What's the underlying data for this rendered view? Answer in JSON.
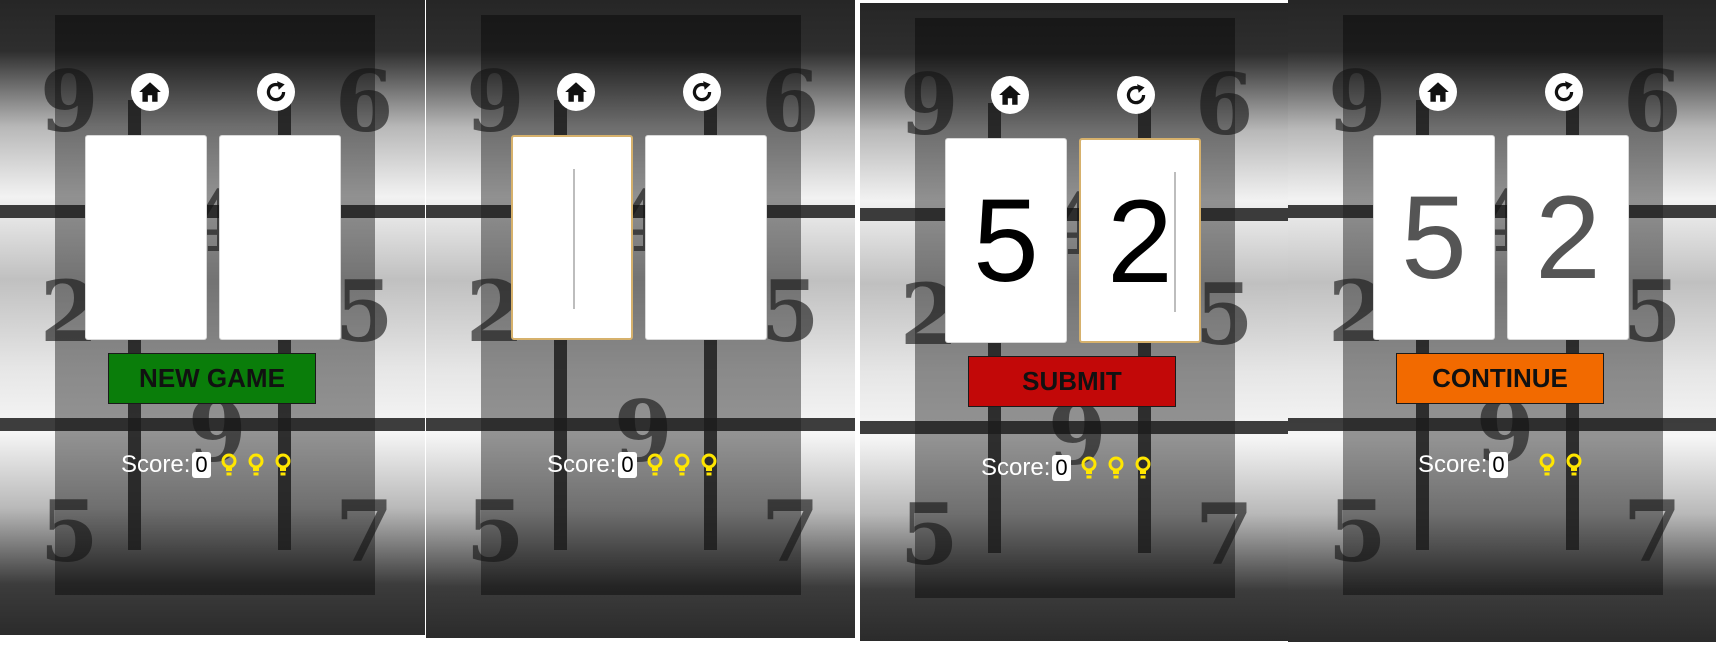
{
  "panels": [
    {
      "state": "new-game",
      "home_icon": "home-icon",
      "restart_icon": "restart-icon",
      "cards": [
        {
          "value": "",
          "focused": false
        },
        {
          "value": "",
          "focused": false
        }
      ],
      "action_label": "NEW GAME",
      "action_color": "#0a7d0a",
      "score_label": "Score:",
      "score_value": "0",
      "hints": 3
    },
    {
      "state": "input-focused",
      "home_icon": "home-icon",
      "restart_icon": "restart-icon",
      "cards": [
        {
          "value": "",
          "focused": true
        },
        {
          "value": "",
          "focused": false
        }
      ],
      "action_label": "",
      "action_color": "",
      "score_label": "Score:",
      "score_value": "0",
      "hints": 3
    },
    {
      "state": "submit",
      "home_icon": "home-icon",
      "restart_icon": "restart-icon",
      "cards": [
        {
          "value": "5",
          "focused": false
        },
        {
          "value": "2",
          "focused": true
        }
      ],
      "action_label": "SUBMIT",
      "action_color": "#c20808",
      "score_label": "Score:",
      "score_value": "0",
      "hints": 3
    },
    {
      "state": "continue",
      "home_icon": "home-icon",
      "restart_icon": "restart-icon",
      "cards": [
        {
          "value": "5",
          "focused": false
        },
        {
          "value": "2",
          "focused": false
        }
      ],
      "action_label": "CONTINUE",
      "action_color": "#f26a00",
      "score_label": "Score:",
      "score_value": "0",
      "hints": 2
    }
  ],
  "background_digits": [
    "9",
    "6",
    "4",
    "2",
    "5",
    "9",
    "5",
    "7"
  ],
  "colors": {
    "hint_bulb": "#ffe600",
    "card_focus_border": "#d6b16c"
  }
}
